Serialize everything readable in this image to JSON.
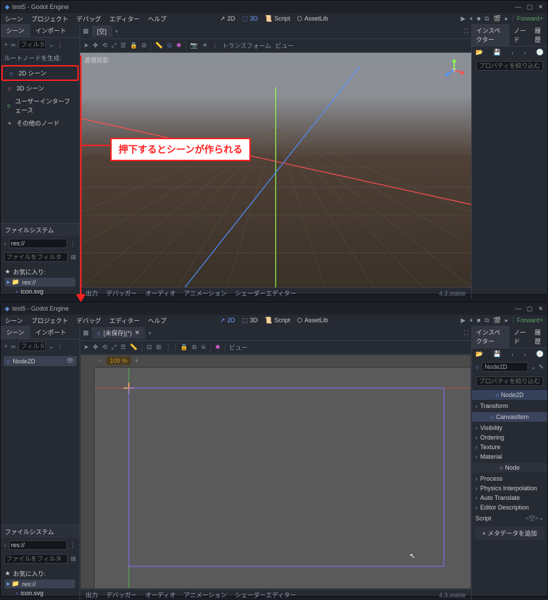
{
  "titlebar": {
    "title": "test5 - Godot Engine"
  },
  "menubar": {
    "scene": "シーン",
    "project": "プロジェクト",
    "debug": "デバッグ",
    "editor": "エディター",
    "help": "ヘルプ"
  },
  "top_tabs": {
    "t2d": "2D",
    "t3d": "3D",
    "script": "Script",
    "assetlib": "AssetLib"
  },
  "top_right": {
    "renderer": "Forward+"
  },
  "scene_panel": {
    "tab_scene": "シーン",
    "tab_import": "インポート",
    "filter": "フィルター: 名前,",
    "root_hdr": "ルートノードを生成:",
    "opt_2d": "2D シーン",
    "opt_3d": "3D シーン",
    "opt_ui": "ユーザーインターフェース",
    "opt_other": "その他のノード"
  },
  "node2d": "Node2D",
  "filesystem": {
    "hdr": "ファイルシステム",
    "path": "res://",
    "filter": "ファイルをフィルタ",
    "fav": "お気に入り:",
    "res_folder": "res://",
    "icon_svg": "icon.svg"
  },
  "center": {
    "empty_tab": "[空]",
    "unsaved": "[未保存](*)",
    "perspective": "透視投影",
    "transform": "トランスフォーム",
    "view": "ビュー",
    "zoom": "100 %"
  },
  "bottombar": {
    "output": "出力",
    "debugger": "デバッガー",
    "audio": "オーディオ",
    "anim": "アニメーション",
    "shader": "シェーダーエディター",
    "ver": "4.3.stable"
  },
  "inspector": {
    "tab_inspector": "インスペクター",
    "tab_node": "ノード",
    "tab_history": "履歴",
    "filter": "プロパティを絞り込む",
    "section_node2d": "Node2D",
    "row_transform": "Transform",
    "section_canvasitem": "CanvasItem",
    "row_visibility": "Visibility",
    "row_ordering": "Ordering",
    "row_texture": "Texture",
    "row_material": "Material",
    "section_node": "Node",
    "row_process": "Process",
    "row_physics": "Physics Interpolation",
    "row_auto": "Auto Translate",
    "row_editor_desc": "Editor Description",
    "row_script": "Script",
    "script_empty": "<空>",
    "add_metadata": "メタデータを追加"
  },
  "callout": "押下するとシーンが作られる"
}
